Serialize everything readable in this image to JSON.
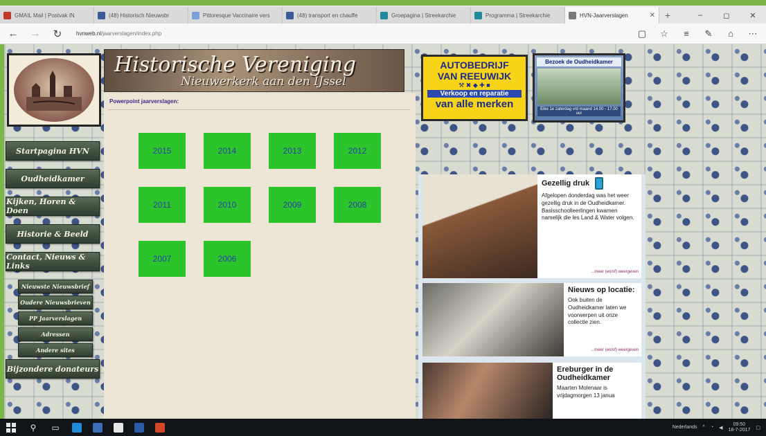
{
  "browser": {
    "tabs": [
      {
        "label": "GMAIL Mail | Postvak IN",
        "favicon_color": "#c0392b",
        "active": false
      },
      {
        "label": "(48) Historisch Nieuwsbr",
        "favicon_color": "#3b5998",
        "active": false
      },
      {
        "label": "Pittoresque Vaccinaire vers",
        "favicon_color": "#7aa0d8",
        "active": false
      },
      {
        "label": "(48) transport en chauffe",
        "favicon_color": "#3b5998",
        "active": false
      },
      {
        "label": "Groepagina | Streekarchie",
        "favicon_color": "#1e8a9c",
        "active": false
      },
      {
        "label": "Programma | Streekarchie",
        "favicon_color": "#1e8a9c",
        "active": false
      },
      {
        "label": "HVN-Jaarverslagen",
        "favicon_color": "#7a7a7a",
        "active": true
      }
    ],
    "new_tab_label": "+",
    "window_controls": [
      "–",
      "◻",
      "✕"
    ],
    "url_domain": "hvnweb.nl",
    "url_path": "/jaarverslagen/index.php",
    "toolbar_icons": [
      "reading-view-icon",
      "favorite-star-icon",
      "hub-icon",
      "web-note-icon",
      "share-icon",
      "more-icon"
    ]
  },
  "site": {
    "banner_title": "Historische Vereniging",
    "banner_subtitle": "Nieuwerkerk aan den IJssel",
    "content_title": "Powerpoint jaarverslagen:",
    "menu": [
      {
        "label": "Startpagina HVN",
        "sub": false
      },
      {
        "label": "Oudheidkamer",
        "sub": false
      },
      {
        "label": "Kijken, Horen & Doen",
        "sub": false
      },
      {
        "label": "Historie & Beeld",
        "sub": false
      },
      {
        "label": "Contact, Nieuws & Links",
        "sub": false
      },
      {
        "label": "Nieuwste Nieuwsbrief",
        "sub": true
      },
      {
        "label": "Oudere Nieuwsbrieven",
        "sub": true
      },
      {
        "label": "PP Jaarverslagen",
        "sub": true
      },
      {
        "label": "Adressen",
        "sub": true
      },
      {
        "label": "Andere sites",
        "sub": true
      },
      {
        "label": "Bijzondere donateurs",
        "sub": false
      }
    ],
    "years": [
      "2015",
      "2014",
      "2013",
      "2012",
      "2011",
      "2010",
      "2009",
      "2008",
      "2007",
      "2006"
    ],
    "ad_garage": {
      "line1": "AUTOBEDRIJF",
      "line2": "VAN REEUWIJK",
      "line3": "Verkoop en reparatie",
      "line4": "van alle merken"
    },
    "ad_museum": {
      "title": "Bezoek de Oudheidkamer",
      "footer": "Elke 1e zaterdag v/d maand 14.00 - 17.00 uur"
    },
    "news": [
      {
        "title": "Gezellig druk",
        "text": "Afgelopen donderdag was het weer gezellig druk in de Oudheidkamer. Basisschoolleerlingen kwamen namelijk die les Land & Water volgen.",
        "more": "...meer (en/of) weergeven"
      },
      {
        "title": "Nieuws op locatie:",
        "text": "Ook buiten de Oudheidkamer laten we voorwerpen uit onze collectie zien.",
        "more": "...meer (en/of) weergeven"
      },
      {
        "title": "Ereburger in de Oudheidkamer",
        "text": "Maarten Molenaar is vrijdagmorgen 13 janua",
        "more": ""
      }
    ]
  },
  "taskbar": {
    "system_text": "Nederlands",
    "time": "09:50",
    "date": "18-7-2017"
  }
}
